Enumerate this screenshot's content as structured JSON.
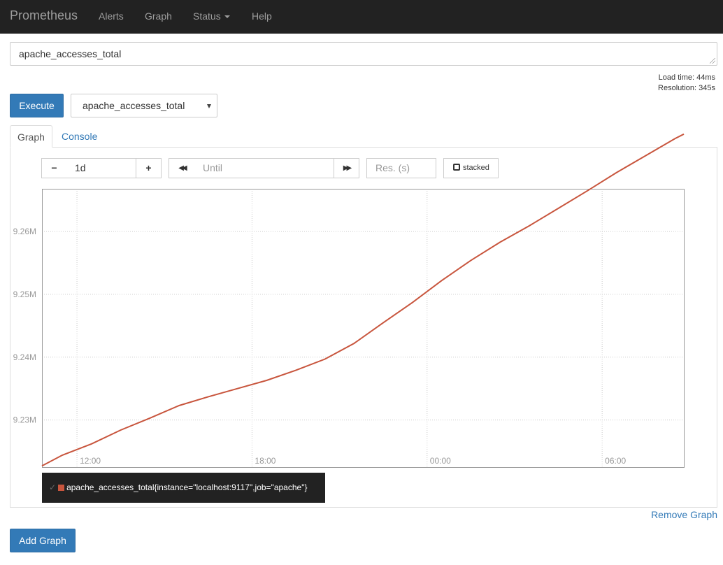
{
  "navbar": {
    "brand": "Prometheus",
    "items": [
      "Alerts",
      "Graph",
      "Status",
      "Help"
    ]
  },
  "expression": {
    "value": "apache_accesses_total"
  },
  "stats": {
    "load_time": "Load time: 44ms",
    "resolution": "Resolution: 345s"
  },
  "controls": {
    "execute_label": "Execute",
    "metric_select": "apache_accesses_total",
    "minus": "−",
    "range": "1d",
    "plus": "+",
    "back": "◀◀",
    "until_placeholder": "Until",
    "forward": "▶▶",
    "res_placeholder": "Res. (s)",
    "stacked_label": "stacked"
  },
  "tabs": [
    "Graph",
    "Console"
  ],
  "colors": {
    "series": "#c8553d",
    "accent": "#337ab7",
    "navbar": "#222222"
  },
  "chart_data": {
    "type": "line",
    "x_ticks": [
      "12:00",
      "18:00",
      "00:00",
      "06:00"
    ],
    "y_ticks": [
      "9.23M",
      "9.24M",
      "9.25M",
      "9.26M"
    ],
    "ylim": [
      9.2225,
      9.2668
    ],
    "grid": true,
    "x_hours": [
      10.8,
      11.5,
      12.5,
      13.5,
      14.5,
      15.5,
      16.5,
      17.5,
      18.5,
      19.5,
      20.5,
      21.5,
      22.5,
      23.5,
      0.5,
      1.5,
      2.5,
      3.5,
      4.5,
      5.5,
      6.5,
      7.5,
      8.5,
      8.8
    ],
    "series": [
      {
        "name": "apache_accesses_total{instance=\"localhost:9117\",job=\"apache\"}",
        "color": "#c8553d",
        "values": [
          9.2227,
          9.2244,
          9.2262,
          9.2284,
          9.2303,
          9.2323,
          9.2337,
          9.235,
          9.2363,
          9.2379,
          9.2397,
          9.2422,
          9.2455,
          9.2487,
          9.2522,
          9.2554,
          9.2583,
          9.2609,
          9.2637,
          9.2665,
          9.2694,
          9.2721,
          9.2748,
          9.2755
        ]
      }
    ],
    "legend": "bottom-left"
  },
  "remove_graph_label": "Remove Graph",
  "add_graph_label": "Add Graph"
}
